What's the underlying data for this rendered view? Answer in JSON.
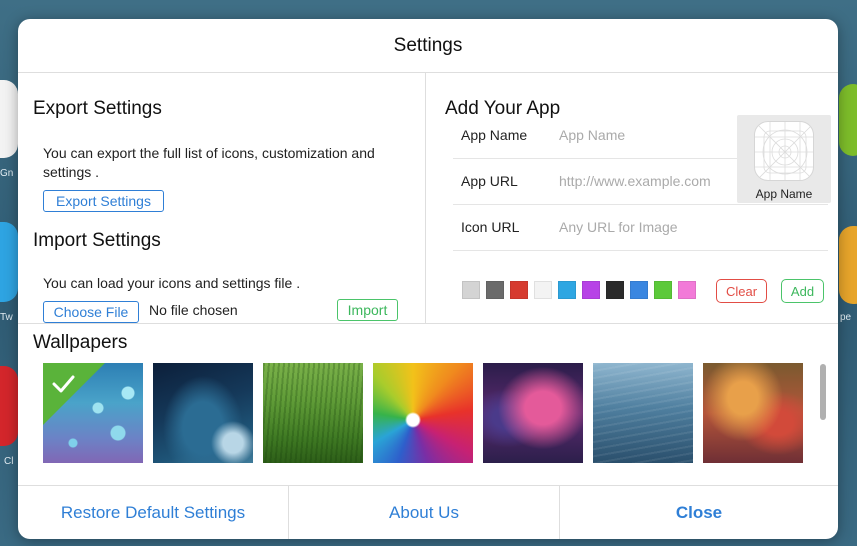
{
  "background": {
    "labels": [
      "Gn",
      "Tw",
      "Cl",
      "pe"
    ]
  },
  "dialog": {
    "title": "Settings"
  },
  "export": {
    "heading": "Export Settings",
    "description": "You can export the full list of icons, customization and settings .",
    "button": "Export Settings"
  },
  "import": {
    "heading": "Import Settings",
    "description": "You can load your icons and settings file .",
    "choose_button": "Choose File",
    "file_status": "No file chosen",
    "import_button": "Import"
  },
  "add_app": {
    "heading": "Add Your App",
    "fields": [
      {
        "label": "App Name",
        "placeholder": "App Name",
        "value": ""
      },
      {
        "label": "App URL",
        "placeholder": "http://www.example.com",
        "value": ""
      },
      {
        "label": "Icon URL",
        "placeholder": "Any URL for Image",
        "value": ""
      }
    ],
    "preview_label": "App Name",
    "colors": [
      "#d4d4d4",
      "#6b6b6b",
      "#d63b30",
      "#f3f3f3",
      "#2ea6e2",
      "#b742e6",
      "#2b2b2b",
      "#3a86e0",
      "#5cc93a",
      "#f27ad8"
    ],
    "clear_button": "Clear",
    "add_button": "Add"
  },
  "wallpapers": {
    "heading": "Wallpapers",
    "selected_index": 0,
    "items": [
      {
        "name": "blue bokeh"
      },
      {
        "name": "dark blue sky"
      },
      {
        "name": "green grass"
      },
      {
        "name": "colorful flower"
      },
      {
        "name": "purple pink blur"
      },
      {
        "name": "blue water"
      },
      {
        "name": "red orange blur"
      }
    ]
  },
  "footer": {
    "restore": "Restore Default Settings",
    "about": "About Us",
    "close": "Close"
  }
}
